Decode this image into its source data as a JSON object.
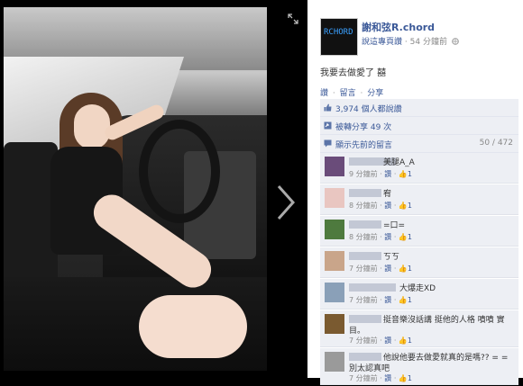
{
  "viewer": {
    "expand_icon": "expand-icon",
    "next_icon": "chevron-right-icon"
  },
  "page": {
    "name": "謝和弦R.chord",
    "avatar_logo": "RCHORD",
    "like_page": "說這專頁讚",
    "time": "54 分鐘前",
    "globe_icon": "globe-icon"
  },
  "post": {
    "text": "我要去做愛了 囍",
    "actions": {
      "like": "讚",
      "comment": "留言",
      "share": "分享"
    }
  },
  "stats": {
    "likes": "3,974 個人都說讚",
    "shares": "被轉分享 49 次",
    "prev_comments": "顯示先前的留言",
    "count": "50 / 472"
  },
  "comments": [
    {
      "text": "美腿A_A",
      "time": "9 分鐘前",
      "like": "讚",
      "likes": "1"
    },
    {
      "text": "宥",
      "time": "8 分鐘前",
      "like": "讚",
      "likes": "1"
    },
    {
      "text": "=口=",
      "time": "8 分鐘前",
      "like": "讚",
      "likes": "1"
    },
    {
      "text": "ㄎㄎ",
      "time": "7 分鐘前",
      "like": "讚",
      "likes": "1"
    },
    {
      "text": "大爆走XD",
      "time": "7 分鐘前",
      "like": "讚",
      "likes": "1"
    },
    {
      "text": "挺音樂沒話講 挺他的人格 噴噴 實",
      "text2": "目。",
      "time": "7 分鐘前",
      "like": "讚",
      "likes": "1"
    },
    {
      "text": "他說他要去做愛就真的是嗎?? = =",
      "text2": "別太認真吧",
      "time": "7 分鐘前",
      "like": "讚",
      "likes": "1"
    }
  ],
  "colors": {
    "link": "#3b5998",
    "panel_bg": "#edeff4"
  }
}
